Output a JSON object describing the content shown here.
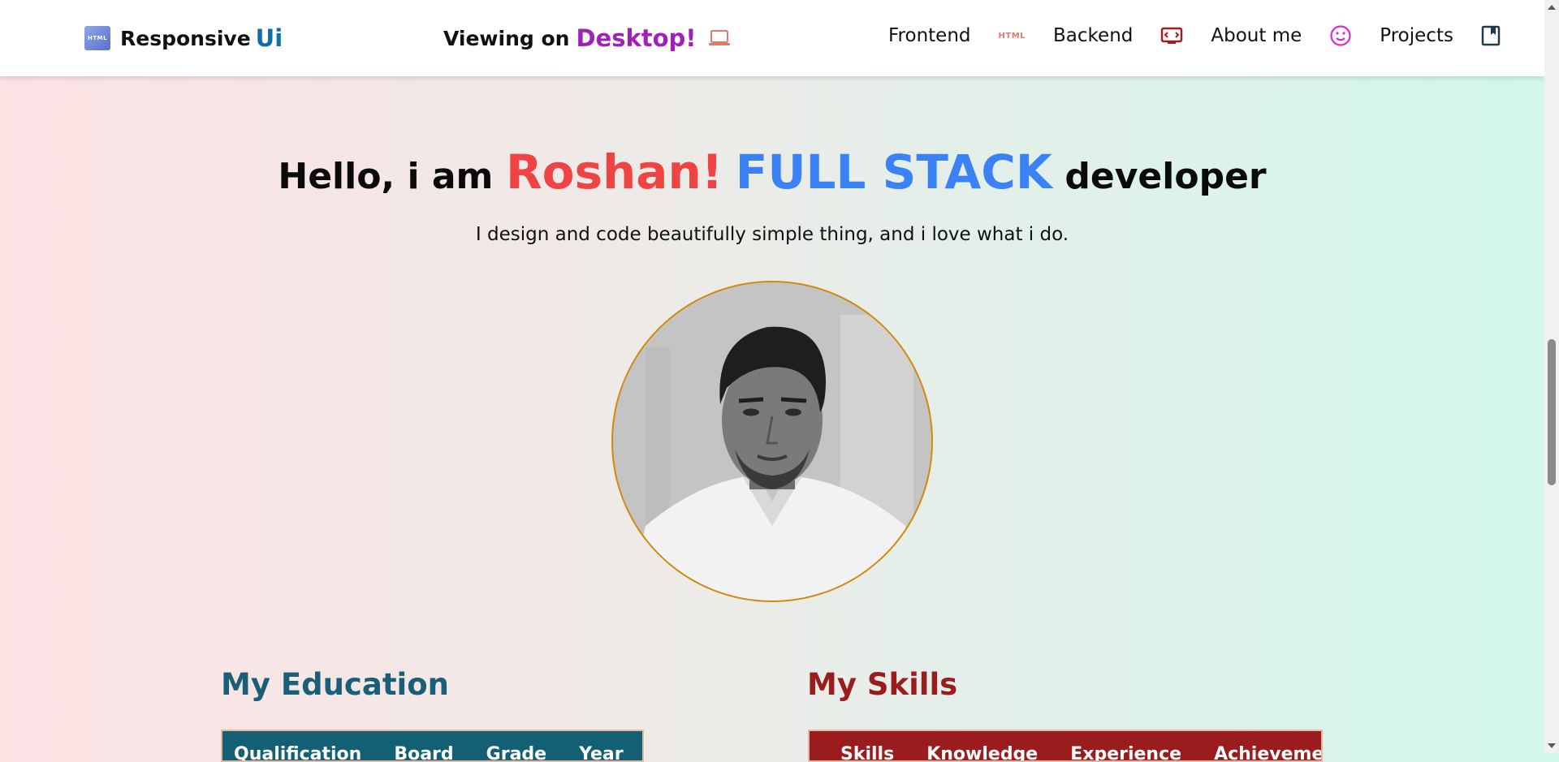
{
  "nav": {
    "brand_logo_text": "HTML",
    "brand_text": "Responsive",
    "brand_accent": "Ui",
    "viewing_text": "Viewing on",
    "viewing_device": "Desktop!",
    "viewing_icon": "laptop-icon",
    "links": [
      {
        "label": "Frontend",
        "icon": "html-icon",
        "icon_text": "HTML"
      },
      {
        "label": "Backend",
        "icon": "code-screen-icon"
      },
      {
        "label": "About me",
        "icon": "smiley-icon"
      },
      {
        "label": "Projects",
        "icon": "bookmark-icon"
      }
    ]
  },
  "hero": {
    "greeting": "Hello, i am",
    "name": "Roshan!",
    "role": "FULL STACK",
    "role_suffix": "developer",
    "subtitle": "I design and code beautifully simple thing, and i love what i do.",
    "avatar": "profile-photo"
  },
  "education": {
    "title": "My Education",
    "headers": [
      "Qualification",
      "Board",
      "Grade",
      "Year"
    ]
  },
  "skills": {
    "title": "My Skills",
    "headers": [
      "Skills",
      "Knowledge",
      "Experience",
      "Achievement"
    ]
  },
  "colors": {
    "brand_accent": "#0e6fa8",
    "device": "#a021b8",
    "name": "#ef4444",
    "role": "#3b82f6",
    "education": "#135f74",
    "skills": "#9b1c1c"
  }
}
